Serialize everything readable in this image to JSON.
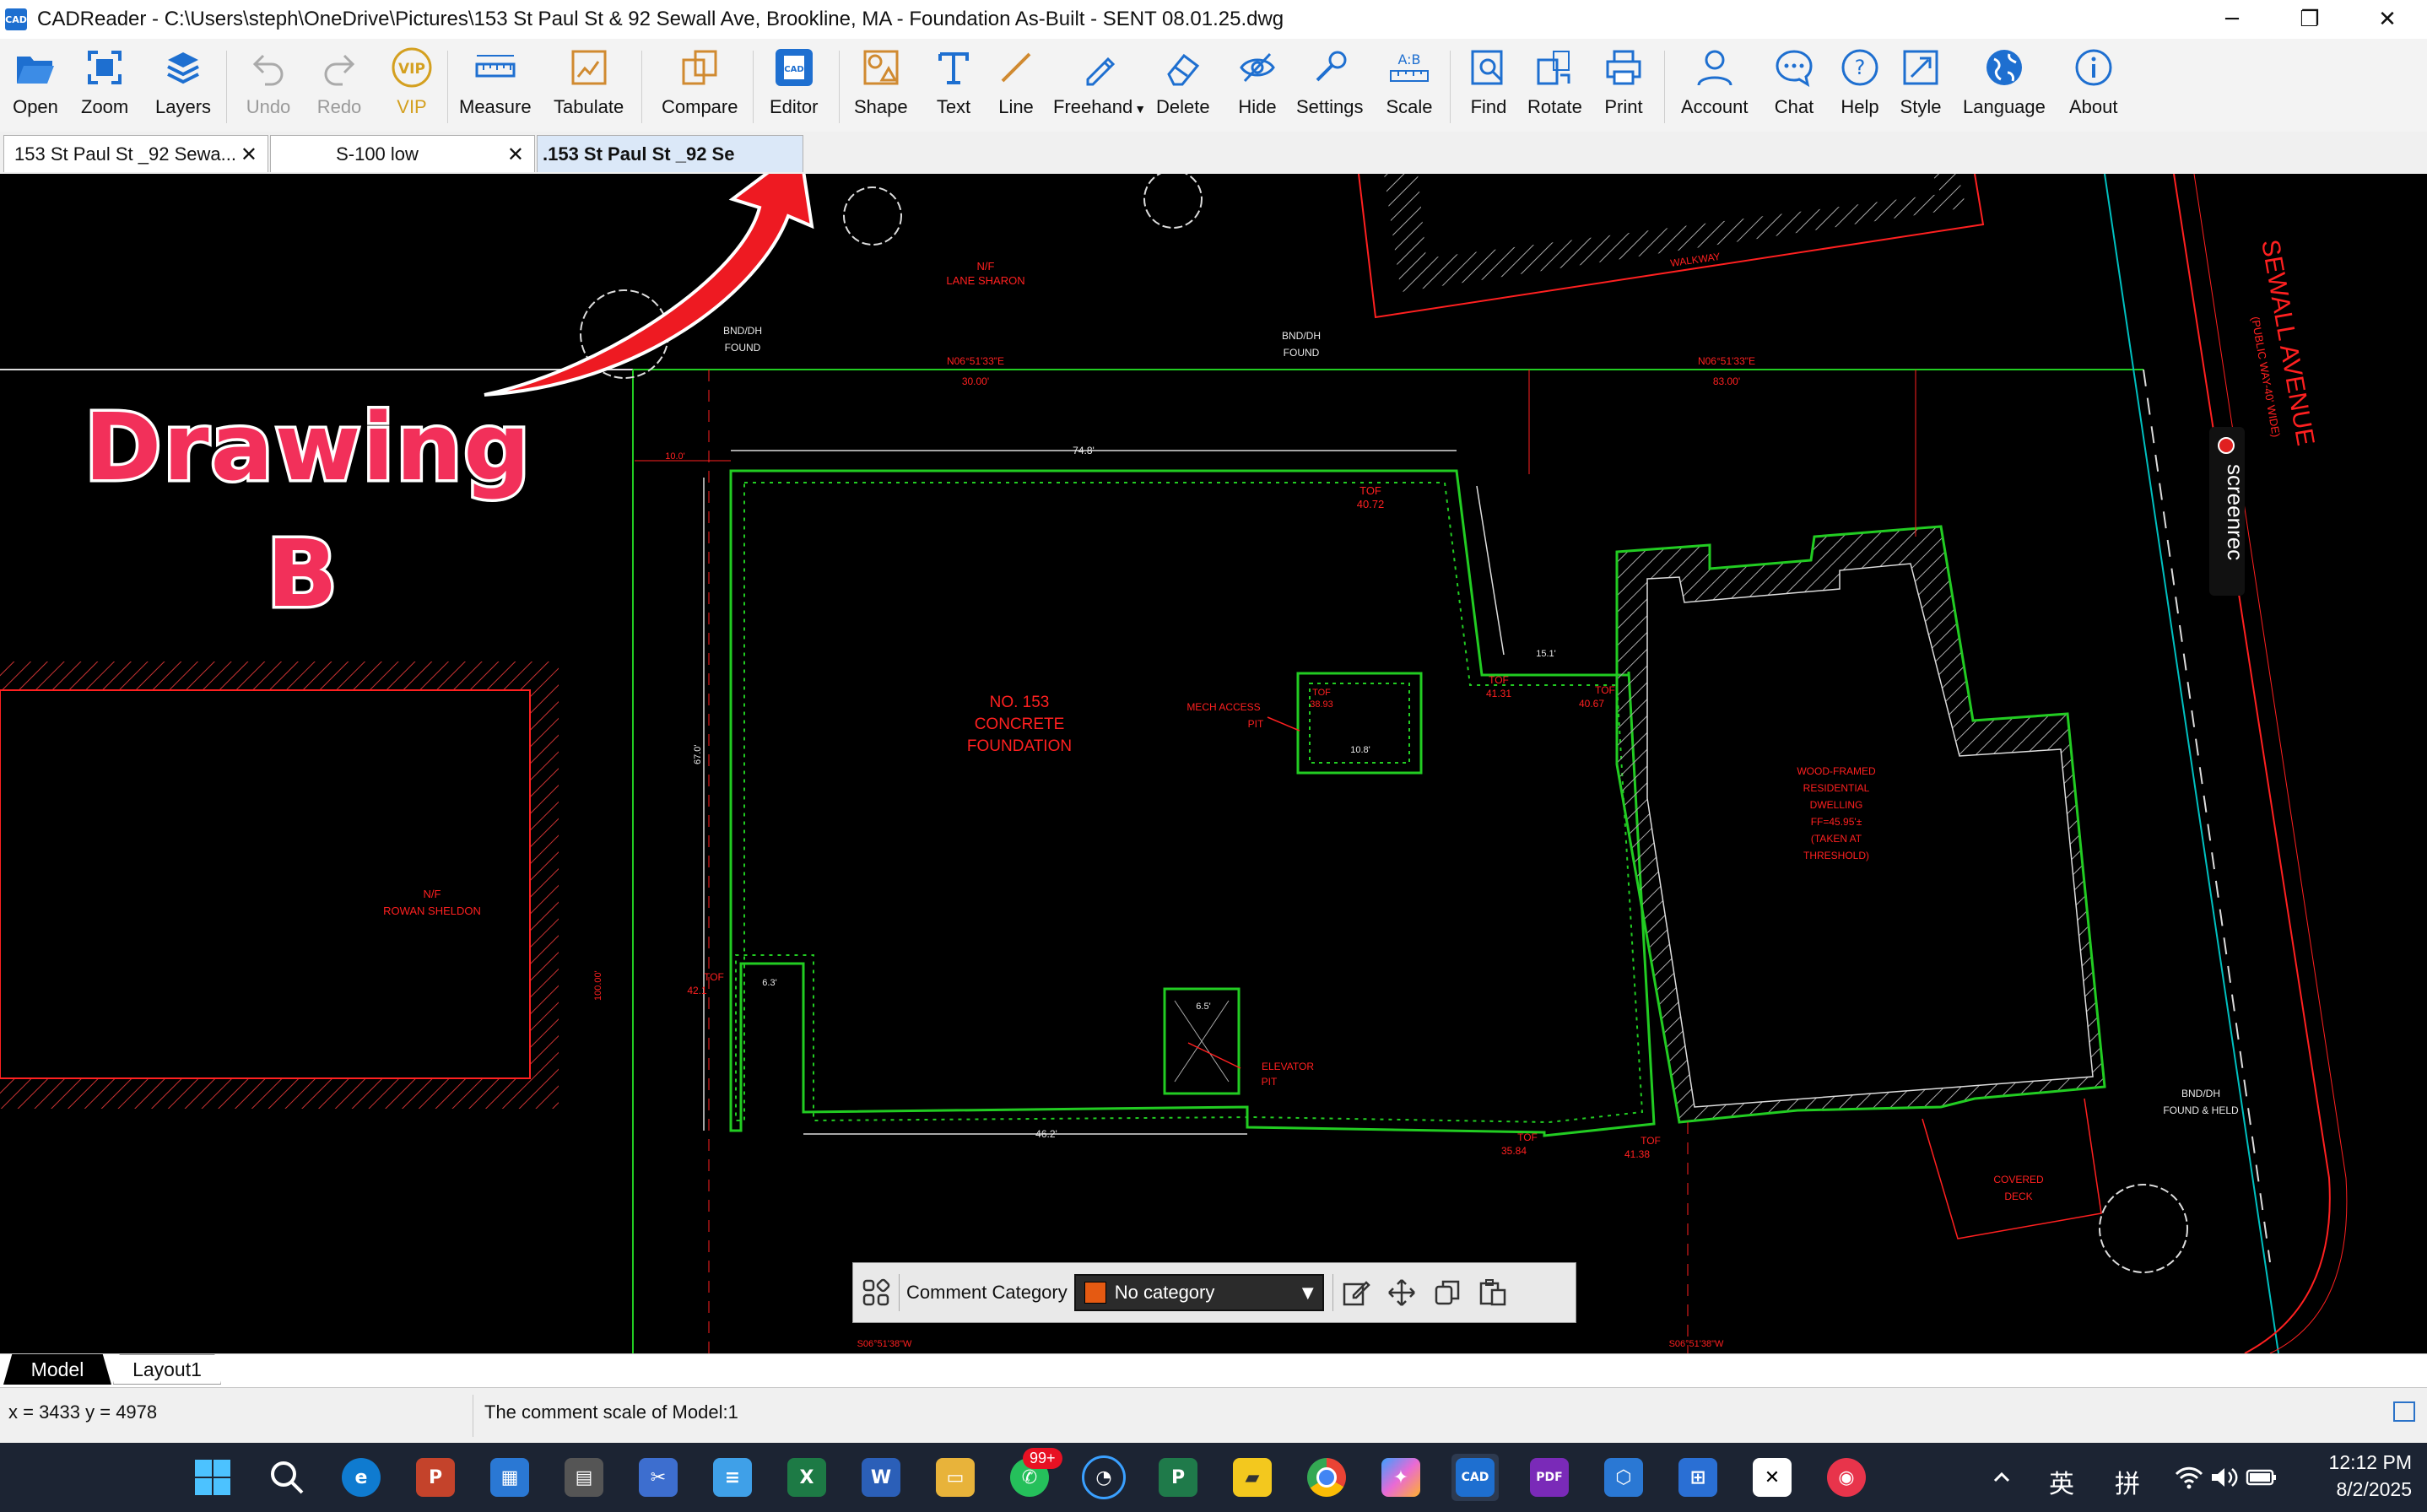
{
  "window": {
    "title": "CADReader - C:\\Users\\steph\\OneDrive\\Pictures\\153 St Paul St & 92 Sewall Ave, Brookline, MA - Foundation As-Built - SENT 08.01.25.dwg",
    "app_icon_text": "CAD",
    "minimize": "─",
    "maximize": "❐",
    "close": "✕"
  },
  "toolbar": {
    "open": "Open",
    "zoom": "Zoom",
    "layers": "Layers",
    "undo": "Undo",
    "redo": "Redo",
    "vip": "VIP",
    "measure": "Measure",
    "tabulate": "Tabulate",
    "compare": "Compare",
    "editor": "Editor",
    "shape": "Shape",
    "text": "Text",
    "line": "Line",
    "freehand": "Freehand",
    "delete": "Delete",
    "hide": "Hide",
    "settings": "Settings",
    "scale": "Scale",
    "find": "Find",
    "rotate": "Rotate",
    "print": "Print",
    "account": "Account",
    "chat": "Chat",
    "help": "Help",
    "style": "Style",
    "language": "Language",
    "about": "About"
  },
  "tabs": [
    {
      "label": "153 St Paul St _92 Sewa...",
      "close": "✕"
    },
    {
      "label": "S-100 low",
      "close": "✕"
    },
    {
      "label": ".153 St Paul St _92 Se"
    }
  ],
  "drawing": {
    "labels": {
      "nf_lane": "N/F\nLANE SHARON",
      "bnd1": "BND/DH",
      "found1": "FOUND",
      "bnd2": "BND/DH",
      "found2": "FOUND",
      "bearing1": "N06°51'33\"E",
      "dist1": "30.00'",
      "bearing2": "N06°51'33\"E",
      "dist2": "83.00'",
      "walkway": "WALKWAY",
      "street": "SEWALL AVENUE",
      "street_sub": "(PUBLIC WAY-40' WIDE)",
      "dim_top": "74.8'",
      "tof1": "TOF",
      "tof1_val": "40.72",
      "concrete1": "NO. 153",
      "concrete2": "CONCRETE",
      "concrete3": "FOUNDATION",
      "mech1": "MECH ACCESS",
      "mech2": "PIT",
      "tof_mech": "TOF",
      "tof_mech_val": "38.93",
      "dim_mech": "10.8'",
      "tof2": "TOF",
      "tof2_val": "41.31",
      "tof3": "TOF",
      "tof3_val": "40.67",
      "dim_15": "15.1'",
      "wood1": "WOOD-FRAMED",
      "wood2": "RESIDENTIAL",
      "wood3": "DWELLING",
      "wood4": "FF=45.95'±",
      "wood5": "(TAKEN AT",
      "wood6": "THRESHOLD)",
      "rowan1": "N/F",
      "rowan2": "ROWAN SHELDON",
      "dim_left": "67.0'",
      "tof_left": "TOF",
      "tof_left_val": "42.1",
      "dim_63": "6.3'",
      "dim_65": "6.5'",
      "elev1": "ELEVATOR",
      "elev2": "PIT",
      "dim_bottom": "46.2'",
      "tof4": "TOF",
      "tof4_val": "35.84",
      "tof5": "TOF",
      "tof5_val": "41.38",
      "bnd3": "BND/DH",
      "found3": "FOUND & HELD",
      "covered1": "COVERED",
      "covered2": "DECK",
      "bearing3": "S06°51'38\"W",
      "bearing4": "S06°51'38\"W",
      "dim_10": "10.0'",
      "dim_100": "100.00'"
    }
  },
  "annotation": {
    "word": "Drawing",
    "letter": "B"
  },
  "screenrec": {
    "text": "screenrec"
  },
  "comment_bar": {
    "category_label": "Comment Category",
    "category_value": "No category",
    "swatch_color": "#e55a12"
  },
  "layout_tabs": {
    "model": "Model",
    "layout1": "Layout1"
  },
  "status": {
    "coords": "x = 3433 y = 4978",
    "scale_msg": "The comment scale of Model:1"
  },
  "taskbar": {
    "badge": "99+",
    "ime1": "英",
    "ime2": "拼",
    "time": "12:12 PM",
    "date": "8/2/2025"
  },
  "colors": {
    "accent": "#1e6fd0",
    "drawing_red": "#ff2020",
    "drawing_green": "#22cc22",
    "annotation_pink": "#f2305a"
  }
}
